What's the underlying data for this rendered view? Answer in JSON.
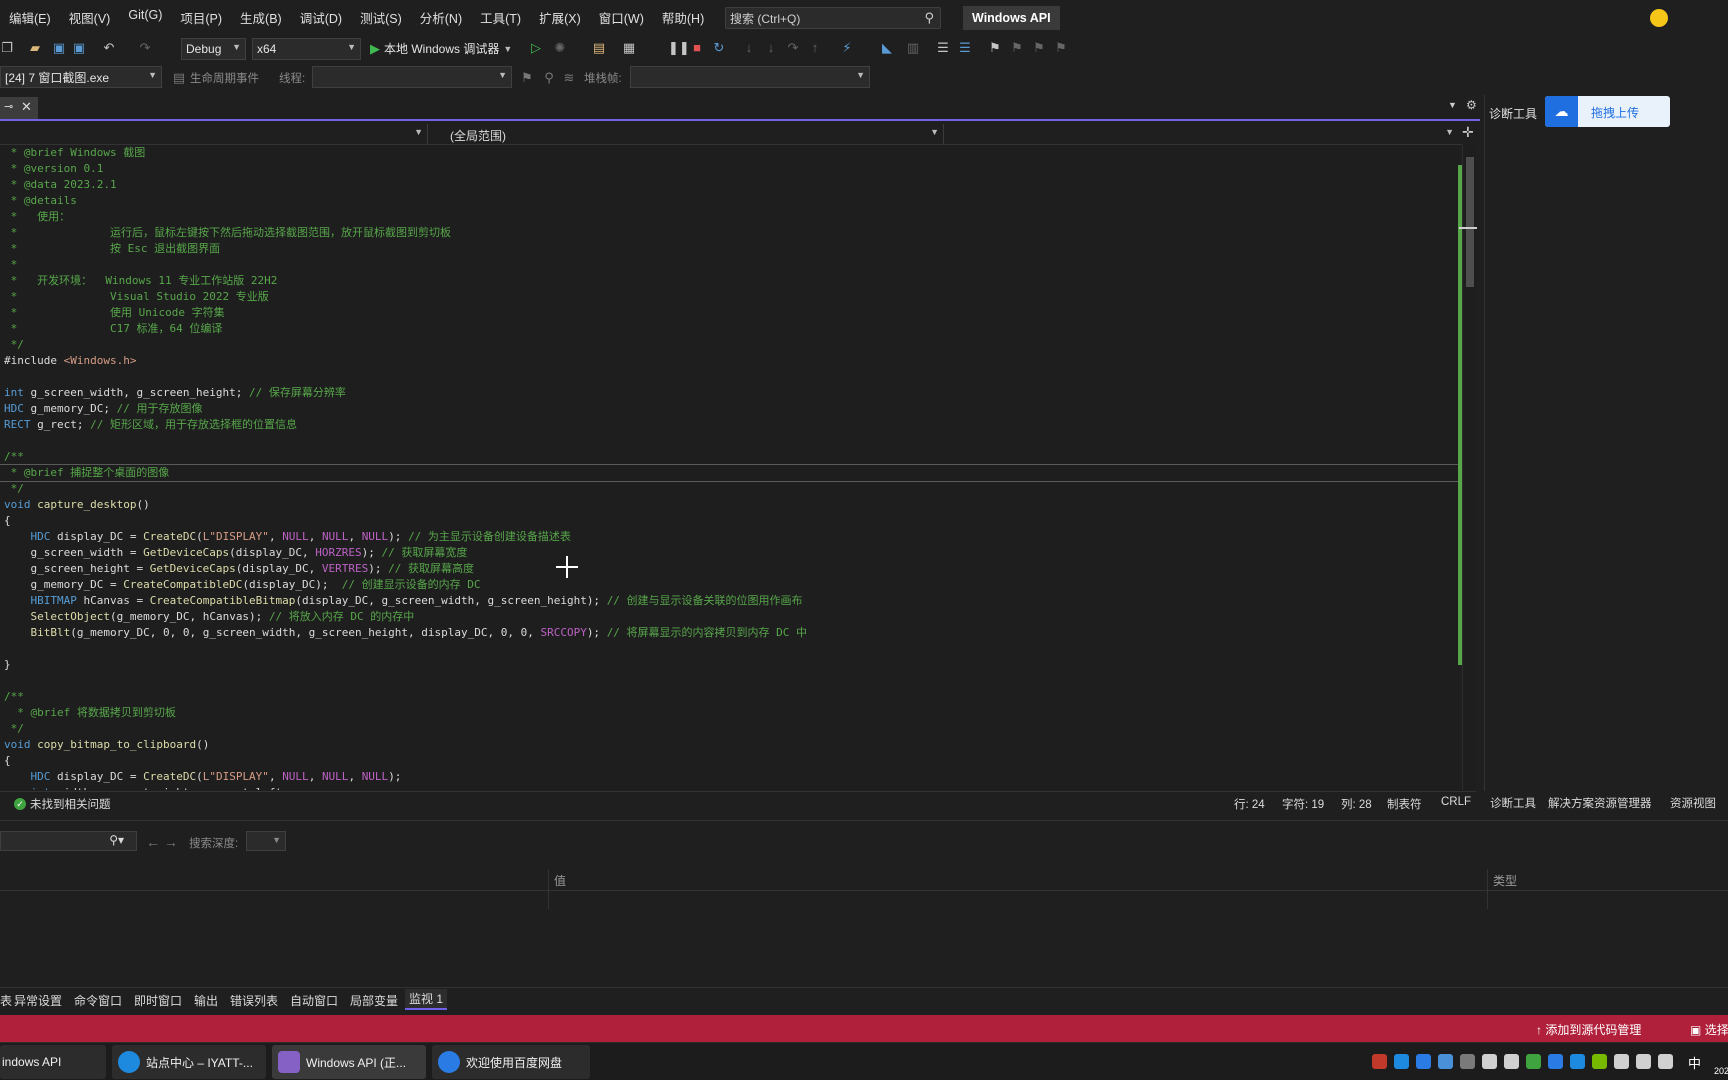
{
  "menu": {
    "items": [
      "编辑(E)",
      "视图(V)",
      "Git(G)",
      "项目(P)",
      "生成(B)",
      "调试(D)",
      "测试(S)",
      "分析(N)",
      "工具(T)",
      "扩展(X)",
      "窗口(W)",
      "帮助(H)"
    ],
    "search_placeholder": "搜索 (Ctrl+Q)",
    "solution_name": "Windows API"
  },
  "toolbar": {
    "configuration": "Debug",
    "platform": "x64",
    "run_label": "本地 Windows 调试器",
    "process": "[24] 7 窗口截图.exe",
    "lifecycle_label": "生命周期事件",
    "thread_label": "线程:",
    "stackframe_label": "堆栈帧:"
  },
  "navbar": {
    "scope": "(全局范围)"
  },
  "code": [
    {
      "text": " * @brief Windows 截图",
      "kind": "comment"
    },
    {
      "text": " * @version 0.1",
      "kind": "comment"
    },
    {
      "text": " * @data 2023.2.1",
      "kind": "comment"
    },
    {
      "text": " * @details",
      "kind": "comment"
    },
    {
      "text": " *   使用：",
      "kind": "comment"
    },
    {
      "text": " *              运行后，鼠标左键按下然后拖动选择截图范围，放开鼠标截图到剪切板",
      "kind": "comment"
    },
    {
      "text": " *              按 Esc 退出截图界面",
      "kind": "comment"
    },
    {
      "text": " *",
      "kind": "comment"
    },
    {
      "text": " *   开发环境：  Windows 11 专业工作站版 22H2",
      "kind": "comment"
    },
    {
      "text": " *              Visual Studio 2022 专业版",
      "kind": "comment"
    },
    {
      "text": " *              使用 Unicode 字符集",
      "kind": "comment"
    },
    {
      "text": " *              C17 标准，64 位编译",
      "kind": "comment"
    },
    {
      "text": " */",
      "kind": "comment"
    },
    {
      "text": "#include <Windows.h>",
      "kind": "code"
    },
    {
      "text": "",
      "kind": "code"
    },
    {
      "text": "int g_screen_width, g_screen_height; // 保存屏幕分辨率",
      "kind": "code"
    },
    {
      "text": "HDC g_memory_DC; // 用于存放图像",
      "kind": "code"
    },
    {
      "text": "RECT g_rect; // 矩形区域，用于存放选择框的位置信息",
      "kind": "code"
    },
    {
      "text": "",
      "kind": "code"
    },
    {
      "text": "/**",
      "kind": "comment"
    },
    {
      "text": " * @brief 捕捉整个桌面的图像",
      "kind": "current"
    },
    {
      "text": " */",
      "kind": "comment"
    },
    {
      "text": "void capture_desktop()",
      "kind": "code"
    },
    {
      "text": "{",
      "kind": "code"
    },
    {
      "text": "    HDC display_DC = CreateDC(L\"DISPLAY\", NULL, NULL, NULL); // 为主显示设备创建设备描述表",
      "kind": "code"
    },
    {
      "text": "    g_screen_width = GetDeviceCaps(display_DC, HORZRES); // 获取屏幕宽度",
      "kind": "code"
    },
    {
      "text": "    g_screen_height = GetDeviceCaps(display_DC, VERTRES); // 获取屏幕高度",
      "kind": "code"
    },
    {
      "text": "    g_memory_DC = CreateCompatibleDC(display_DC);  // 创建显示设备的内存 DC",
      "kind": "code"
    },
    {
      "text": "    HBITMAP hCanvas = CreateCompatibleBitmap(display_DC, g_screen_width, g_screen_height); // 创建与显示设备关联的位图用作画布",
      "kind": "code"
    },
    {
      "text": "    SelectObject(g_memory_DC, hCanvas); // 将放入内存 DC 的内存中",
      "kind": "code"
    },
    {
      "text": "    BitBlt(g_memory_DC, 0, 0, g_screen_width, g_screen_height, display_DC, 0, 0, SRCCOPY); // 将屏幕显示的内容拷贝到内存 DC 中",
      "kind": "code"
    },
    {
      "text": "",
      "kind": "code"
    },
    {
      "text": "}",
      "kind": "code"
    },
    {
      "text": "",
      "kind": "code"
    },
    {
      "text": "/**",
      "kind": "comment"
    },
    {
      "text": "  * @brief 将数据拷贝到剪切板",
      "kind": "comment"
    },
    {
      "text": " */",
      "kind": "comment"
    },
    {
      "text": "void copy_bitmap_to_clipboard()",
      "kind": "code"
    },
    {
      "text": "{",
      "kind": "code"
    },
    {
      "text": "    HDC display_DC = CreateDC(L\"DISPLAY\", NULL, NULL, NULL);",
      "kind": "code"
    },
    {
      "text": "    int width = g_rect.right - g_rect.left;",
      "kind": "code"
    }
  ],
  "editor_status": {
    "issues": "未找到相关问题",
    "line": "行: 24",
    "char": "字符: 19",
    "col": "列: 28",
    "tabs": "制表符",
    "eol": "CRLF"
  },
  "right_panel": {
    "title": "诊断工具",
    "upload_label": "拖拽上传",
    "tabs": [
      "诊断工具",
      "解决方案资源管理器",
      "资源视图"
    ]
  },
  "watch": {
    "depth_label": "搜索深度:",
    "col_value": "值",
    "col_type": "类型"
  },
  "bottom_tabs": [
    "异常设置",
    "命令窗口",
    "即时窗口",
    "输出",
    "错误列表",
    "自动窗口",
    "局部变量",
    "监视 1"
  ],
  "status_bar": {
    "source_control": "添加到源代码管理",
    "select_repo": "选择"
  },
  "taskbar": {
    "apps": [
      {
        "label": "indows API",
        "color": "#7160e8"
      },
      {
        "label": "站点中心 – IYATT-...",
        "color": "#1d8ae0"
      },
      {
        "label": "Windows API (正...",
        "color": "#8661c5"
      },
      {
        "label": "欢迎使用百度网盘",
        "color": "#2b7be4"
      }
    ],
    "lang": "中",
    "date": "202"
  },
  "colors": {
    "accent": "#7160e8",
    "statusbar": "#b1203a",
    "comment": "#57a64a",
    "keyword": "#569cd6",
    "string": "#d69d85",
    "macro": "#bd63c5",
    "function": "#dcdcaa",
    "type": "#4ec9b0"
  }
}
